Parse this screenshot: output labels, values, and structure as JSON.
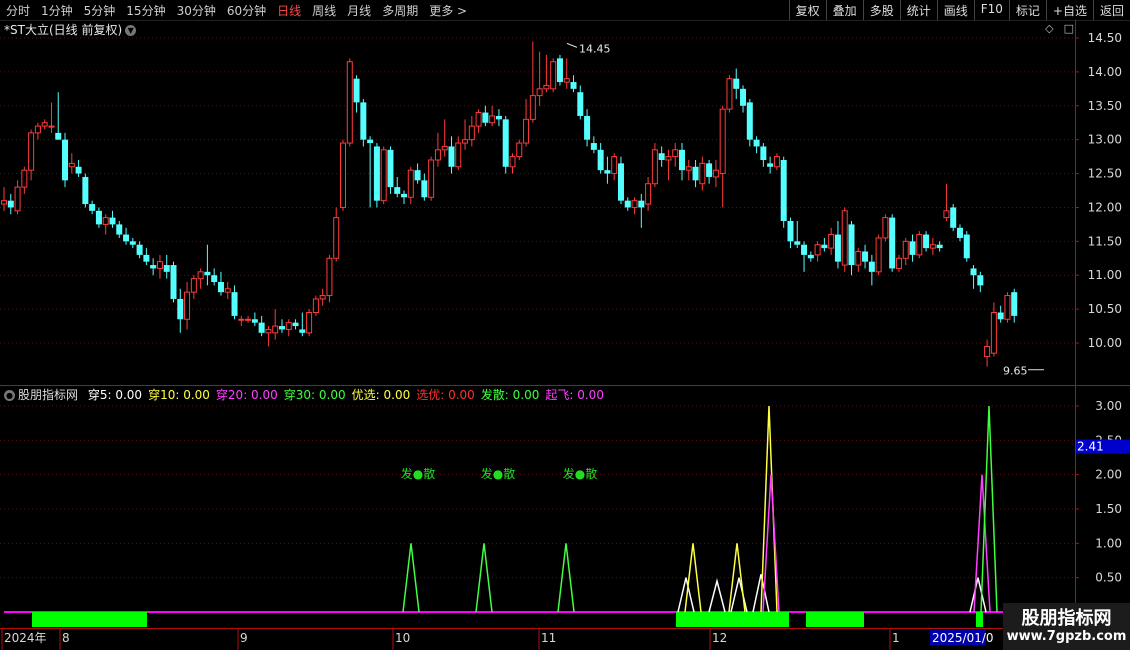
{
  "toolbar": {
    "periods": [
      "分时",
      "1分钟",
      "5分钟",
      "15分钟",
      "30分钟",
      "60分钟",
      "日线",
      "周线",
      "月线",
      "多周期",
      "更多 >"
    ],
    "active_period": "日线",
    "right_tools": [
      "复权",
      "叠加",
      "多股",
      "统计",
      "画线",
      "F10",
      "标记",
      "+自选",
      "返回"
    ]
  },
  "main_chart": {
    "title": "*ST大立(日线 前复权)",
    "high_label": "14.45",
    "low_label": "9.65",
    "y_ticks": [
      "14.50",
      "14.00",
      "13.50",
      "13.00",
      "12.50",
      "12.00",
      "11.50",
      "11.00",
      "10.50",
      "10.00"
    ]
  },
  "indicator": {
    "name": "股朋指标网",
    "values": [
      {
        "label": "穿5:",
        "value": "0.00",
        "color": "#ffffff"
      },
      {
        "label": "穿10:",
        "value": "0.00",
        "color": "#ffff40"
      },
      {
        "label": "穿20:",
        "value": "0.00",
        "color": "#ff40ff"
      },
      {
        "label": "穿30:",
        "value": "0.00",
        "color": "#40ff40"
      },
      {
        "label": "优选:",
        "value": "0.00",
        "color": "#ffff40"
      },
      {
        "label": "选优:",
        "value": "0.00",
        "color": "#ff3030"
      },
      {
        "label": "发散:",
        "value": "0.00",
        "color": "#40ff40"
      },
      {
        "label": "起飞:",
        "value": "0.00",
        "color": "#ff40ff"
      }
    ],
    "y_ticks": [
      "3.00",
      "2.50",
      "2.00",
      "1.50",
      "1.00",
      "0.50"
    ],
    "current_value": "2.41",
    "signal_label": "发●散"
  },
  "date_axis": {
    "labels": [
      "2024年",
      "8",
      "9",
      "10",
      "11",
      "12",
      "1"
    ],
    "cursor_date": "2025/01/0"
  },
  "watermark": {
    "title": "股朋指标网",
    "url": "www.7gpzb.com"
  },
  "colors": {
    "up": "#ff3b3b",
    "down": "#54ffff",
    "green": "#00ff00",
    "magenta": "#ff00ff",
    "axis_red": "#b01010"
  },
  "chart_data": {
    "type": "candlestick",
    "ylim": [
      9.5,
      14.7
    ],
    "candles": [
      {
        "o": 12.05,
        "h": 12.3,
        "l": 11.95,
        "c": 12.1
      },
      {
        "o": 12.1,
        "h": 12.2,
        "l": 11.9,
        "c": 12.0
      },
      {
        "o": 11.95,
        "h": 12.4,
        "l": 11.9,
        "c": 12.3
      },
      {
        "o": 12.3,
        "h": 12.6,
        "l": 12.2,
        "c": 12.55
      },
      {
        "o": 12.55,
        "h": 13.15,
        "l": 12.4,
        "c": 13.1
      },
      {
        "o": 13.1,
        "h": 13.25,
        "l": 13.0,
        "c": 13.2
      },
      {
        "o": 13.2,
        "h": 13.3,
        "l": 13.15,
        "c": 13.25
      },
      {
        "o": 13.2,
        "h": 13.55,
        "l": 13.1,
        "c": 13.2
      },
      {
        "o": 13.1,
        "h": 13.7,
        "l": 13.0,
        "c": 13.0
      },
      {
        "o": 13.0,
        "h": 13.1,
        "l": 12.3,
        "c": 12.4
      },
      {
        "o": 12.6,
        "h": 12.8,
        "l": 12.5,
        "c": 12.65
      },
      {
        "o": 12.6,
        "h": 12.7,
        "l": 12.45,
        "c": 12.5
      },
      {
        "o": 12.45,
        "h": 12.5,
        "l": 12.0,
        "c": 12.05
      },
      {
        "o": 12.05,
        "h": 12.1,
        "l": 11.9,
        "c": 11.95
      },
      {
        "o": 11.95,
        "h": 12.0,
        "l": 11.7,
        "c": 11.75
      },
      {
        "o": 11.75,
        "h": 11.9,
        "l": 11.6,
        "c": 11.85
      },
      {
        "o": 11.85,
        "h": 11.95,
        "l": 11.7,
        "c": 11.75
      },
      {
        "o": 11.75,
        "h": 11.8,
        "l": 11.55,
        "c": 11.6
      },
      {
        "o": 11.6,
        "h": 11.7,
        "l": 11.45,
        "c": 11.5
      },
      {
        "o": 11.5,
        "h": 11.55,
        "l": 11.4,
        "c": 11.45
      },
      {
        "o": 11.45,
        "h": 11.5,
        "l": 11.25,
        "c": 11.3
      },
      {
        "o": 11.3,
        "h": 11.4,
        "l": 11.15,
        "c": 11.2
      },
      {
        "o": 11.15,
        "h": 11.25,
        "l": 11.0,
        "c": 11.1
      },
      {
        "o": 11.1,
        "h": 11.3,
        "l": 10.95,
        "c": 11.2
      },
      {
        "o": 11.15,
        "h": 11.3,
        "l": 10.95,
        "c": 11.05
      },
      {
        "o": 11.15,
        "h": 11.2,
        "l": 10.6,
        "c": 10.65
      },
      {
        "o": 10.65,
        "h": 10.8,
        "l": 10.15,
        "c": 10.35
      },
      {
        "o": 10.35,
        "h": 10.9,
        "l": 10.2,
        "c": 10.75
      },
      {
        "o": 10.75,
        "h": 11.0,
        "l": 10.65,
        "c": 10.95
      },
      {
        "o": 10.95,
        "h": 11.1,
        "l": 10.8,
        "c": 11.05
      },
      {
        "o": 11.05,
        "h": 11.45,
        "l": 10.85,
        "c": 11.0
      },
      {
        "o": 11.0,
        "h": 11.1,
        "l": 10.85,
        "c": 10.9
      },
      {
        "o": 10.9,
        "h": 11.05,
        "l": 10.7,
        "c": 10.75
      },
      {
        "o": 10.75,
        "h": 10.9,
        "l": 10.65,
        "c": 10.8
      },
      {
        "o": 10.75,
        "h": 10.85,
        "l": 10.35,
        "c": 10.4
      },
      {
        "o": 10.35,
        "h": 10.4,
        "l": 10.25,
        "c": 10.35
      },
      {
        "o": 10.35,
        "h": 10.4,
        "l": 10.3,
        "c": 10.35
      },
      {
        "o": 10.35,
        "h": 10.45,
        "l": 10.25,
        "c": 10.3
      },
      {
        "o": 10.3,
        "h": 10.4,
        "l": 10.1,
        "c": 10.15
      },
      {
        "o": 10.15,
        "h": 10.25,
        "l": 9.95,
        "c": 10.2
      },
      {
        "o": 10.15,
        "h": 10.5,
        "l": 10.05,
        "c": 10.25
      },
      {
        "o": 10.25,
        "h": 10.35,
        "l": 10.15,
        "c": 10.2
      },
      {
        "o": 10.2,
        "h": 10.35,
        "l": 10.1,
        "c": 10.3
      },
      {
        "o": 10.3,
        "h": 10.35,
        "l": 10.2,
        "c": 10.25
      },
      {
        "o": 10.2,
        "h": 10.45,
        "l": 10.1,
        "c": 10.15
      },
      {
        "o": 10.15,
        "h": 10.5,
        "l": 10.1,
        "c": 10.45
      },
      {
        "o": 10.45,
        "h": 10.7,
        "l": 10.4,
        "c": 10.65
      },
      {
        "o": 10.65,
        "h": 10.8,
        "l": 10.55,
        "c": 10.7
      },
      {
        "o": 10.7,
        "h": 11.3,
        "l": 10.6,
        "c": 11.25
      },
      {
        "o": 11.25,
        "h": 12.0,
        "l": 11.2,
        "c": 11.85
      },
      {
        "o": 12.0,
        "h": 13.0,
        "l": 11.95,
        "c": 12.95
      },
      {
        "o": 12.95,
        "h": 14.2,
        "l": 12.9,
        "c": 14.15
      },
      {
        "o": 13.9,
        "h": 13.95,
        "l": 13.4,
        "c": 13.55
      },
      {
        "o": 13.55,
        "h": 13.6,
        "l": 12.9,
        "c": 13.0
      },
      {
        "o": 13.0,
        "h": 13.05,
        "l": 12.0,
        "c": 12.95
      },
      {
        "o": 12.9,
        "h": 12.95,
        "l": 12.0,
        "c": 12.1
      },
      {
        "o": 12.1,
        "h": 12.9,
        "l": 12.05,
        "c": 12.85
      },
      {
        "o": 12.85,
        "h": 12.9,
        "l": 12.2,
        "c": 12.3
      },
      {
        "o": 12.3,
        "h": 12.45,
        "l": 12.15,
        "c": 12.2
      },
      {
        "o": 12.2,
        "h": 12.25,
        "l": 12.05,
        "c": 12.15
      },
      {
        "o": 12.15,
        "h": 12.6,
        "l": 12.05,
        "c": 12.55
      },
      {
        "o": 12.55,
        "h": 12.65,
        "l": 12.35,
        "c": 12.4
      },
      {
        "o": 12.4,
        "h": 12.5,
        "l": 12.1,
        "c": 12.15
      },
      {
        "o": 12.15,
        "h": 12.75,
        "l": 12.1,
        "c": 12.7
      },
      {
        "o": 12.7,
        "h": 13.1,
        "l": 12.6,
        "c": 12.85
      },
      {
        "o": 12.85,
        "h": 13.3,
        "l": 12.75,
        "c": 12.9
      },
      {
        "o": 12.9,
        "h": 13.05,
        "l": 12.5,
        "c": 12.6
      },
      {
        "o": 12.6,
        "h": 13.05,
        "l": 12.55,
        "c": 12.95
      },
      {
        "o": 12.95,
        "h": 13.3,
        "l": 12.85,
        "c": 13.0
      },
      {
        "o": 13.0,
        "h": 13.35,
        "l": 12.9,
        "c": 13.2
      },
      {
        "o": 13.2,
        "h": 13.45,
        "l": 13.1,
        "c": 13.4
      },
      {
        "o": 13.4,
        "h": 13.5,
        "l": 13.2,
        "c": 13.25
      },
      {
        "o": 13.25,
        "h": 13.5,
        "l": 13.2,
        "c": 13.35
      },
      {
        "o": 13.35,
        "h": 13.45,
        "l": 13.2,
        "c": 13.3
      },
      {
        "o": 13.3,
        "h": 13.35,
        "l": 12.5,
        "c": 12.6
      },
      {
        "o": 12.6,
        "h": 12.8,
        "l": 12.5,
        "c": 12.75
      },
      {
        "o": 12.75,
        "h": 13.0,
        "l": 12.7,
        "c": 12.95
      },
      {
        "o": 12.95,
        "h": 13.6,
        "l": 12.9,
        "c": 13.3
      },
      {
        "o": 13.3,
        "h": 14.45,
        "l": 13.25,
        "c": 13.65
      },
      {
        "o": 13.65,
        "h": 14.3,
        "l": 13.5,
        "c": 13.75
      },
      {
        "o": 13.75,
        "h": 14.25,
        "l": 13.7,
        "c": 13.8
      },
      {
        "o": 13.75,
        "h": 14.2,
        "l": 13.7,
        "c": 14.15
      },
      {
        "o": 14.2,
        "h": 14.25,
        "l": 13.8,
        "c": 13.85
      },
      {
        "o": 13.85,
        "h": 14.2,
        "l": 13.75,
        "c": 13.9
      },
      {
        "o": 13.85,
        "h": 13.95,
        "l": 13.7,
        "c": 13.75
      },
      {
        "o": 13.7,
        "h": 13.8,
        "l": 13.3,
        "c": 13.35
      },
      {
        "o": 13.35,
        "h": 13.45,
        "l": 12.9,
        "c": 13.0
      },
      {
        "o": 12.95,
        "h": 13.05,
        "l": 12.8,
        "c": 12.85
      },
      {
        "o": 12.85,
        "h": 12.95,
        "l": 12.5,
        "c": 12.55
      },
      {
        "o": 12.55,
        "h": 12.75,
        "l": 12.35,
        "c": 12.5
      },
      {
        "o": 12.5,
        "h": 12.8,
        "l": 12.4,
        "c": 12.75
      },
      {
        "o": 12.65,
        "h": 12.75,
        "l": 12.05,
        "c": 12.1
      },
      {
        "o": 12.1,
        "h": 12.15,
        "l": 11.95,
        "c": 12.0
      },
      {
        "o": 12.0,
        "h": 12.15,
        "l": 11.9,
        "c": 12.1
      },
      {
        "o": 12.1,
        "h": 12.2,
        "l": 11.7,
        "c": 12.0
      },
      {
        "o": 12.05,
        "h": 12.45,
        "l": 11.95,
        "c": 12.35
      },
      {
        "o": 12.35,
        "h": 12.95,
        "l": 12.3,
        "c": 12.85
      },
      {
        "o": 12.8,
        "h": 12.9,
        "l": 12.6,
        "c": 12.7
      },
      {
        "o": 12.7,
        "h": 12.85,
        "l": 12.4,
        "c": 12.75
      },
      {
        "o": 12.75,
        "h": 12.95,
        "l": 12.6,
        "c": 12.85
      },
      {
        "o": 12.85,
        "h": 12.95,
        "l": 12.4,
        "c": 12.55
      },
      {
        "o": 12.55,
        "h": 12.7,
        "l": 12.4,
        "c": 12.6
      },
      {
        "o": 12.6,
        "h": 12.7,
        "l": 12.3,
        "c": 12.4
      },
      {
        "o": 12.35,
        "h": 12.75,
        "l": 12.25,
        "c": 12.65
      },
      {
        "o": 12.65,
        "h": 12.7,
        "l": 12.35,
        "c": 12.45
      },
      {
        "o": 12.45,
        "h": 12.7,
        "l": 12.3,
        "c": 12.55
      },
      {
        "o": 12.5,
        "h": 13.5,
        "l": 12.0,
        "c": 13.45
      },
      {
        "o": 13.45,
        "h": 13.95,
        "l": 13.4,
        "c": 13.9
      },
      {
        "o": 13.9,
        "h": 14.05,
        "l": 13.6,
        "c": 13.75
      },
      {
        "o": 13.75,
        "h": 13.8,
        "l": 13.4,
        "c": 13.5
      },
      {
        "o": 13.55,
        "h": 13.6,
        "l": 12.9,
        "c": 13.0
      },
      {
        "o": 13.0,
        "h": 13.05,
        "l": 12.8,
        "c": 12.9
      },
      {
        "o": 12.9,
        "h": 12.95,
        "l": 12.6,
        "c": 12.7
      },
      {
        "o": 12.65,
        "h": 12.75,
        "l": 12.5,
        "c": 12.6
      },
      {
        "o": 12.6,
        "h": 12.8,
        "l": 12.55,
        "c": 12.75
      },
      {
        "o": 12.7,
        "h": 12.75,
        "l": 11.7,
        "c": 11.8
      },
      {
        "o": 11.8,
        "h": 11.85,
        "l": 11.4,
        "c": 11.5
      },
      {
        "o": 11.5,
        "h": 11.8,
        "l": 11.4,
        "c": 11.45
      },
      {
        "o": 11.45,
        "h": 11.5,
        "l": 11.05,
        "c": 11.3
      },
      {
        "o": 11.3,
        "h": 11.35,
        "l": 11.2,
        "c": 11.25
      },
      {
        "o": 11.3,
        "h": 11.5,
        "l": 11.2,
        "c": 11.45
      },
      {
        "o": 11.45,
        "h": 11.55,
        "l": 11.35,
        "c": 11.4
      },
      {
        "o": 11.4,
        "h": 11.7,
        "l": 11.3,
        "c": 11.6
      },
      {
        "o": 11.6,
        "h": 11.8,
        "l": 11.1,
        "c": 11.2
      },
      {
        "o": 11.15,
        "h": 12.0,
        "l": 11.05,
        "c": 11.95
      },
      {
        "o": 11.75,
        "h": 11.8,
        "l": 11.0,
        "c": 11.15
      },
      {
        "o": 11.15,
        "h": 11.4,
        "l": 11.05,
        "c": 11.35
      },
      {
        "o": 11.35,
        "h": 11.45,
        "l": 11.1,
        "c": 11.2
      },
      {
        "o": 11.2,
        "h": 11.3,
        "l": 10.85,
        "c": 11.05
      },
      {
        "o": 11.05,
        "h": 11.6,
        "l": 11.0,
        "c": 11.55
      },
      {
        "o": 11.55,
        "h": 11.9,
        "l": 11.5,
        "c": 11.85
      },
      {
        "o": 11.85,
        "h": 11.9,
        "l": 11.05,
        "c": 11.1
      },
      {
        "o": 11.1,
        "h": 11.3,
        "l": 11.05,
        "c": 11.25
      },
      {
        "o": 11.25,
        "h": 11.55,
        "l": 11.15,
        "c": 11.5
      },
      {
        "o": 11.5,
        "h": 11.6,
        "l": 11.2,
        "c": 11.3
      },
      {
        "o": 11.3,
        "h": 11.65,
        "l": 11.25,
        "c": 11.6
      },
      {
        "o": 11.6,
        "h": 11.65,
        "l": 11.35,
        "c": 11.4
      },
      {
        "o": 11.4,
        "h": 11.55,
        "l": 11.3,
        "c": 11.45
      },
      {
        "o": 11.45,
        "h": 11.5,
        "l": 11.35,
        "c": 11.4
      },
      {
        "o": 11.85,
        "h": 12.35,
        "l": 11.8,
        "c": 11.95
      },
      {
        "o": 12.0,
        "h": 12.05,
        "l": 11.65,
        "c": 11.7
      },
      {
        "o": 11.7,
        "h": 11.75,
        "l": 11.5,
        "c": 11.55
      },
      {
        "o": 11.6,
        "h": 11.65,
        "l": 11.2,
        "c": 11.25
      },
      {
        "o": 11.1,
        "h": 11.15,
        "l": 10.8,
        "c": 11.0
      },
      {
        "o": 11.0,
        "h": 11.05,
        "l": 10.75,
        "c": 10.85
      },
      {
        "o": 9.8,
        "h": 10.05,
        "l": 9.65,
        "c": 9.95
      },
      {
        "o": 9.85,
        "h": 10.6,
        "l": 9.8,
        "c": 10.45
      },
      {
        "o": 10.45,
        "h": 10.55,
        "l": 10.3,
        "c": 10.35
      },
      {
        "o": 10.35,
        "h": 10.75,
        "l": 10.3,
        "c": 10.7
      },
      {
        "o": 10.75,
        "h": 10.8,
        "l": 10.3,
        "c": 10.4
      }
    ],
    "indicator_series": [
      {
        "name": "穿5",
        "color": "#ffffff",
        "peaks": [
          [
            686,
            0.5
          ],
          [
            717,
            0.45
          ],
          [
            739,
            0.5
          ],
          [
            761,
            0.55
          ],
          [
            978,
            0.5
          ]
        ]
      },
      {
        "name": "穿10",
        "color": "#ffff40",
        "peaks": [
          [
            693,
            1.0
          ],
          [
            737,
            1.0
          ],
          [
            769,
            3.0
          ]
        ]
      },
      {
        "name": "穿20",
        "color": "#ff40ff",
        "peaks": [
          [
            771,
            2.0
          ],
          [
            982,
            2.0
          ]
        ]
      },
      {
        "name": "穿30",
        "color": "#40ff40",
        "peaks": [
          [
            411,
            1.0
          ],
          [
            484,
            1.0
          ],
          [
            566,
            1.0
          ],
          [
            989,
            3.0
          ]
        ]
      }
    ],
    "signal_bars": [
      [
        32,
        147
      ],
      [
        676,
        789
      ],
      [
        806,
        864
      ],
      [
        976,
        983
      ]
    ]
  }
}
